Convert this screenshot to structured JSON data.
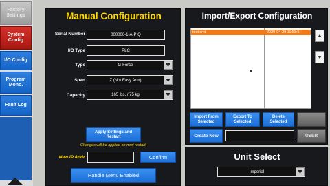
{
  "sidebar": {
    "items": [
      {
        "label": "Factory Settings"
      },
      {
        "label": "System Config"
      },
      {
        "label": "I/O Config"
      },
      {
        "label": "Program Mono."
      },
      {
        "label": "Fault Log"
      }
    ]
  },
  "manual": {
    "title": "Manual Configuration",
    "serial_label": "Serial Number",
    "serial_value": "000000-1-A-PIQ",
    "io_label": "I/O Type",
    "io_value": "PLC",
    "type_label": "Type",
    "type_value": "G-Force",
    "span_label": "Span",
    "span_value": "Z (Not Easy Arm)",
    "capacity_label": "Capacity",
    "capacity_value": "165 lbs. / 75 kg",
    "apply_label": "Apply Settings and Restart",
    "restart_note": "Changes will be applied on next restart!",
    "ip_label": "New IP Addr.",
    "ip_value": "",
    "confirm_label": "Confirm",
    "handle_menu_label": "Handle Menu Enabled"
  },
  "import_export": {
    "title": "Import/Export Configuration",
    "file_name": "test.cmt",
    "file_date": "2020-04-29 11:58:5",
    "import_label": "Import From Selected",
    "export_label": "Export To Selected",
    "delete_label": "Delete Selected",
    "disabled_label": "",
    "create_label": "Create New",
    "new_name_value": "",
    "user_label": "USER"
  },
  "unit_select": {
    "title": "Unit Select",
    "value": "Imperial"
  },
  "colors": {
    "accent_blue": "#1c6fd6",
    "title_yellow": "#ffd600",
    "selection_orange": "#f07a1a",
    "active_red": "#c0221c"
  }
}
